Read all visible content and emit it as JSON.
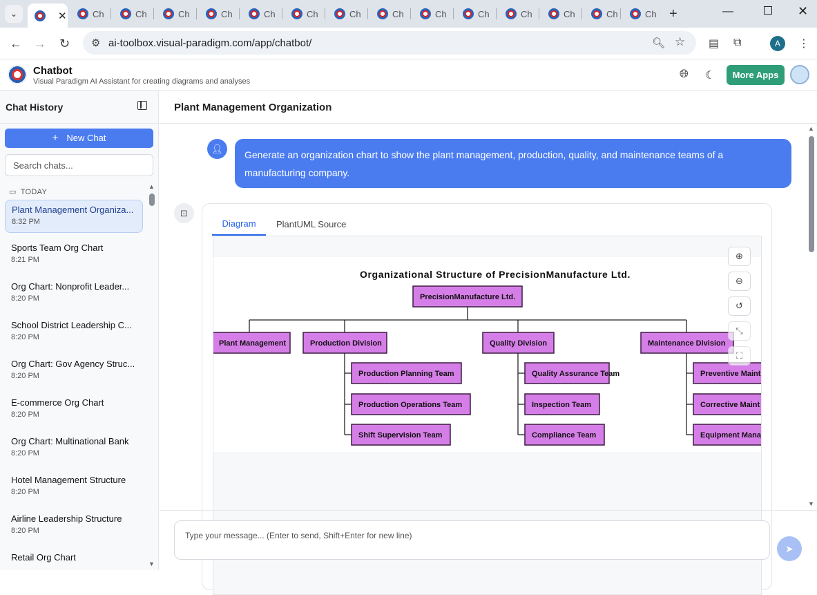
{
  "browser": {
    "tabs": [
      {
        "label": "",
        "active": true
      },
      {
        "label": "Ch"
      },
      {
        "label": "Ch"
      },
      {
        "label": "Ch"
      },
      {
        "label": "Ch"
      },
      {
        "label": "Ch"
      },
      {
        "label": "Ch"
      },
      {
        "label": "Ch"
      },
      {
        "label": "Ch"
      },
      {
        "label": "Ch"
      },
      {
        "label": "Ch"
      },
      {
        "label": "Ch"
      },
      {
        "label": "Ch"
      },
      {
        "label": "Ch"
      },
      {
        "label": "Ch"
      }
    ],
    "url": "ai-toolbox.visual-paradigm.com/app/chatbot/",
    "profile_initial": "A"
  },
  "app": {
    "title": "Chatbot",
    "subtitle": "Visual Paradigm AI Assistant for creating diagrams and analyses",
    "more_apps_label": "More Apps"
  },
  "sidebar": {
    "title": "Chat History",
    "new_chat_label": "New Chat",
    "search_placeholder": "Search chats...",
    "section_label": "TODAY",
    "items": [
      {
        "title": "Plant Management Organiza...",
        "time": "8:32 PM",
        "active": true
      },
      {
        "title": "Sports Team Org Chart",
        "time": "8:21 PM"
      },
      {
        "title": "Org Chart: Nonprofit Leader...",
        "time": "8:20 PM"
      },
      {
        "title": "School District Leadership C...",
        "time": "8:20 PM"
      },
      {
        "title": "Org Chart: Gov Agency Struc...",
        "time": "8:20 PM"
      },
      {
        "title": "E-commerce Org Chart",
        "time": "8:20 PM"
      },
      {
        "title": "Org Chart: Multinational Bank",
        "time": "8:20 PM"
      },
      {
        "title": "Hotel Management Structure",
        "time": "8:20 PM"
      },
      {
        "title": "Airline Leadership Structure",
        "time": "8:20 PM"
      },
      {
        "title": "Retail Org Chart",
        "time": ""
      }
    ]
  },
  "main": {
    "conversation_title": "Plant Management Organization",
    "user_message": "Generate an organization chart to show the plant management, production, quality, and maintenance teams of a manufacturing company.",
    "response_tabs": [
      "Diagram",
      "PlantUML Source"
    ],
    "input_placeholder": "Type your message... (Enter to send, Shift+Enter for new line)"
  },
  "diagram": {
    "title": "Organizational Structure of PrecisionManufacture Ltd.",
    "root": "PrecisionManufacture Ltd.",
    "divisions": [
      {
        "name": "Plant Management",
        "teams": []
      },
      {
        "name": "Production Division",
        "teams": [
          "Production Planning Team",
          "Production Operations Team",
          "Shift Supervision Team"
        ]
      },
      {
        "name": "Quality Division",
        "teams": [
          "Quality Assurance Team",
          "Inspection Team",
          "Compliance Team"
        ]
      },
      {
        "name": "Maintenance Division",
        "teams": [
          "Preventive Maint",
          "Corrective Maint",
          "Equipment Mana"
        ]
      }
    ],
    "box_fill": "#d67ee8",
    "box_stroke": "#3a1f40"
  }
}
